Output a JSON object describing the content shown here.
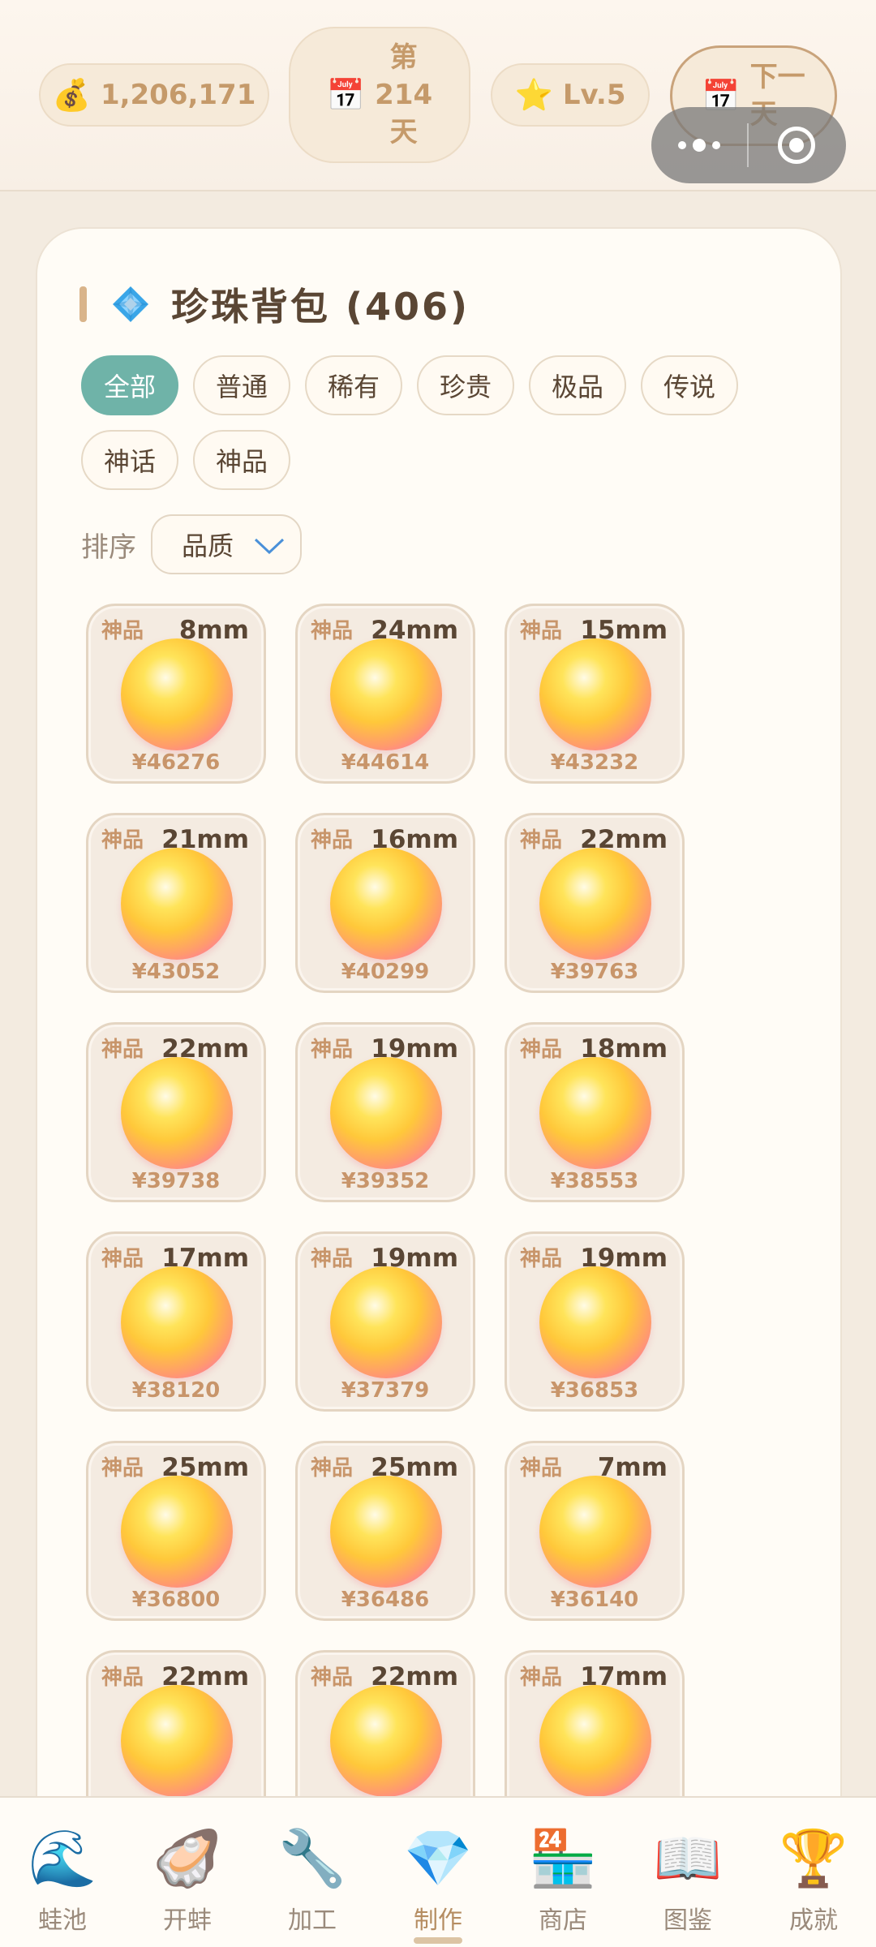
{
  "header": {
    "coins": {
      "icon": "money-bag-icon",
      "value": "1,206,171"
    },
    "day": {
      "icon": "calendar-icon",
      "line1": "第",
      "line2": "214",
      "line3": "天"
    },
    "level": {
      "icon": "star-icon",
      "value": "Lv.5"
    },
    "next_day": {
      "icon": "calendar-icon",
      "line1": "下一",
      "line2": "天"
    }
  },
  "panel": {
    "title": "珍珠背包 (406)",
    "title_icon": "diamond-emblem-icon",
    "filters": [
      "全部",
      "普通",
      "稀有",
      "珍贵",
      "极品",
      "传说",
      "神话",
      "神品"
    ],
    "active_filter": "全部",
    "sort_label": "排序",
    "sort_value": "品质",
    "pearls": [
      {
        "rarity": "神品",
        "size": "8mm",
        "price": "¥46276"
      },
      {
        "rarity": "神品",
        "size": "24mm",
        "price": "¥44614"
      },
      {
        "rarity": "神品",
        "size": "15mm",
        "price": "¥43232"
      },
      {
        "rarity": "神品",
        "size": "21mm",
        "price": "¥43052"
      },
      {
        "rarity": "神品",
        "size": "16mm",
        "price": "¥40299"
      },
      {
        "rarity": "神品",
        "size": "22mm",
        "price": "¥39763"
      },
      {
        "rarity": "神品",
        "size": "22mm",
        "price": "¥39738"
      },
      {
        "rarity": "神品",
        "size": "19mm",
        "price": "¥39352"
      },
      {
        "rarity": "神品",
        "size": "18mm",
        "price": "¥38553"
      },
      {
        "rarity": "神品",
        "size": "17mm",
        "price": "¥38120"
      },
      {
        "rarity": "神品",
        "size": "19mm",
        "price": "¥37379"
      },
      {
        "rarity": "神品",
        "size": "19mm",
        "price": "¥36853"
      },
      {
        "rarity": "神品",
        "size": "25mm",
        "price": "¥36800"
      },
      {
        "rarity": "神品",
        "size": "25mm",
        "price": "¥36486"
      },
      {
        "rarity": "神品",
        "size": "7mm",
        "price": "¥36140"
      },
      {
        "rarity": "神品",
        "size": "22mm",
        "price": ""
      },
      {
        "rarity": "神品",
        "size": "22mm",
        "price": ""
      },
      {
        "rarity": "神品",
        "size": "17mm",
        "price": ""
      }
    ]
  },
  "nav": {
    "active": "制作",
    "items": [
      {
        "label": "蛙池",
        "icon": "wave-icon",
        "glyph": "🌊"
      },
      {
        "label": "开蚌",
        "icon": "oyster-icon",
        "glyph": "🦪"
      },
      {
        "label": "加工",
        "icon": "wrench-icon",
        "glyph": "🔧"
      },
      {
        "label": "制作",
        "icon": "gem-icon",
        "glyph": "💎"
      },
      {
        "label": "商店",
        "icon": "store-icon",
        "glyph": "🏪"
      },
      {
        "label": "图鉴",
        "icon": "book-icon",
        "glyph": "📖"
      },
      {
        "label": "成就",
        "icon": "trophy-icon",
        "glyph": "🏆"
      }
    ]
  },
  "colors": {
    "accent": "#6fb3a8",
    "gold_text": "#c59a6a",
    "background": "#f3ebe0"
  }
}
